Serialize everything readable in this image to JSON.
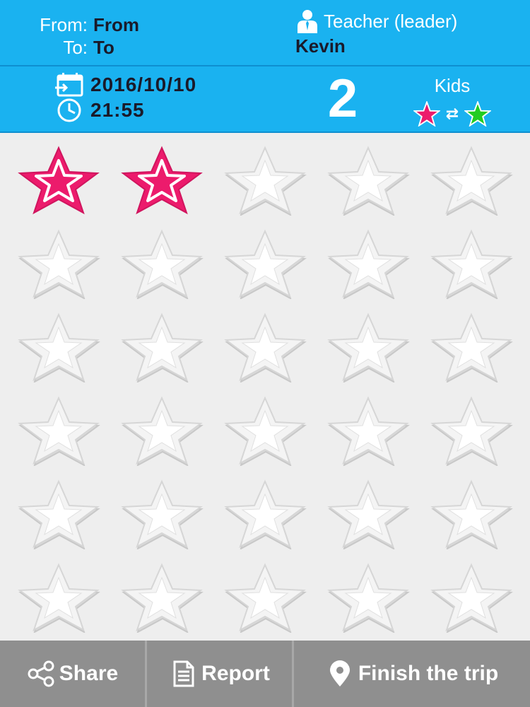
{
  "header": {
    "from_label": "From:",
    "from_value": "From",
    "to_label": "To:",
    "to_value": "To",
    "role": "Teacher (leader)",
    "teacher_name": "Kevin",
    "date": "2016/10/10",
    "time": "21:55",
    "count": "2",
    "kids_label": "Kids",
    "kids_swap": "⇄",
    "icons": {
      "teacher": "person-icon",
      "date": "calendar-icon",
      "time": "clock-icon",
      "kids_pink": "pink-star-icon",
      "kids_green": "green-star-icon"
    }
  },
  "grid": {
    "columns": 5,
    "rows": 6,
    "checked_count": 2,
    "total": 30,
    "checked_color": "#ec1b6c",
    "empty_color": "#ffffff"
  },
  "footer": {
    "share_label": "Share",
    "report_label": "Report",
    "finish_label": "Finish the trip",
    "icons": {
      "share": "share-icon",
      "report": "document-icon",
      "finish": "map-pin-icon"
    }
  },
  "colors": {
    "header_bg": "#1ab2f0",
    "dark_text": "#1a1a2a",
    "footer_bg": "#8f8f8f",
    "pink": "#ec1b6c",
    "green": "#22cc22"
  }
}
